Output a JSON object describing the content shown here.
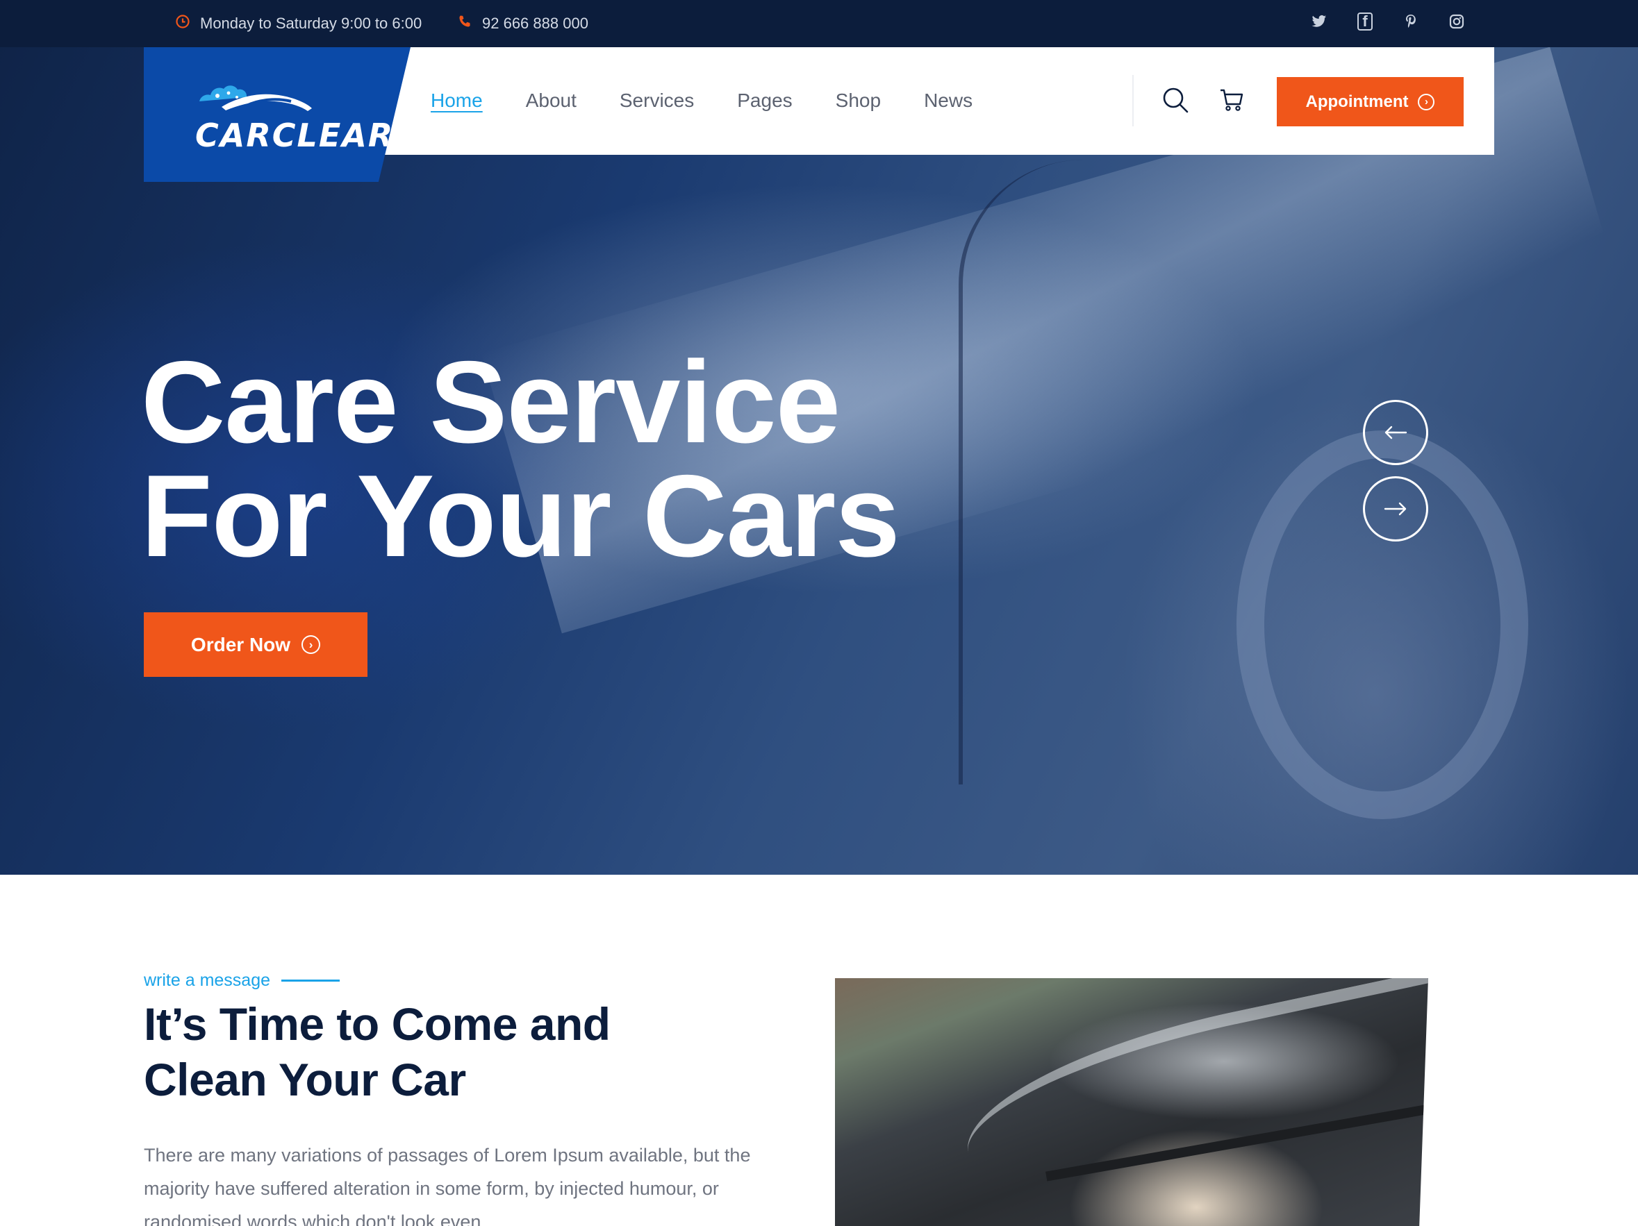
{
  "topbar": {
    "hours": "Monday to Saturday 9:00 to 6:00",
    "phone": "92 666 888 000",
    "social": [
      "twitter-icon",
      "facebook-icon",
      "pinterest-icon",
      "instagram-icon"
    ]
  },
  "logo": {
    "text": "CARCLEAR"
  },
  "nav": {
    "items": [
      {
        "label": "Home",
        "active": true
      },
      {
        "label": "About"
      },
      {
        "label": "Services"
      },
      {
        "label": "Pages"
      },
      {
        "label": "Shop"
      },
      {
        "label": "News"
      }
    ],
    "appointment_label": "Appointment"
  },
  "hero": {
    "title_line1": "Care Service",
    "title_line2": "For Your Cars",
    "cta_label": "Order Now",
    "prev_icon": "arrow-left-icon",
    "next_icon": "arrow-right-icon"
  },
  "about": {
    "tagline": "write a message",
    "title_line1": "It’s Time to Come and",
    "title_line2": "Clean Your Car",
    "text": "There are many variations of passages of Lorem Ipsum available, but the majority have suffered alteration in some form, by injected humour, or randomised words which don't look even."
  },
  "colors": {
    "accent": "#f0561a",
    "link_active": "#1aa3e8",
    "brand_blue": "#0b4aa8",
    "navy": "#0c1d3c"
  }
}
